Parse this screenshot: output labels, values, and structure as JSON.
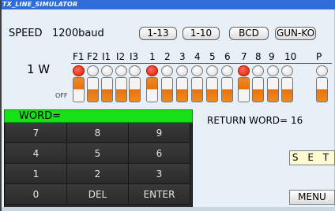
{
  "window": {
    "title": "TX_LINE_SIMULATOR"
  },
  "speed": {
    "label": "SPEED",
    "value": "1200baud"
  },
  "mode_buttons": [
    "1-13",
    "1-10",
    "BCD",
    "GUN-KO"
  ],
  "bit_headers": [
    "F1",
    "F2",
    "I1",
    "I2",
    "I3",
    "1",
    "2",
    "3",
    "4",
    "5",
    "6",
    "7",
    "8",
    "9",
    "10",
    "P"
  ],
  "bit_row_label": "1 W",
  "off_label": "OFF",
  "bit_states": [
    1,
    0,
    0,
    0,
    0,
    1,
    0,
    0,
    0,
    0,
    0,
    1,
    0,
    0,
    0,
    0
  ],
  "keypad": {
    "word_label": "WORD=",
    "keys": [
      "7",
      "8",
      "9",
      "4",
      "5",
      "6",
      "1",
      "2",
      "3",
      "0",
      "DEL",
      "ENTER"
    ]
  },
  "return_word": {
    "label": "RETURN WORD=",
    "value": "16"
  },
  "buttons": {
    "set": "S E T",
    "menu": "MENU"
  }
}
